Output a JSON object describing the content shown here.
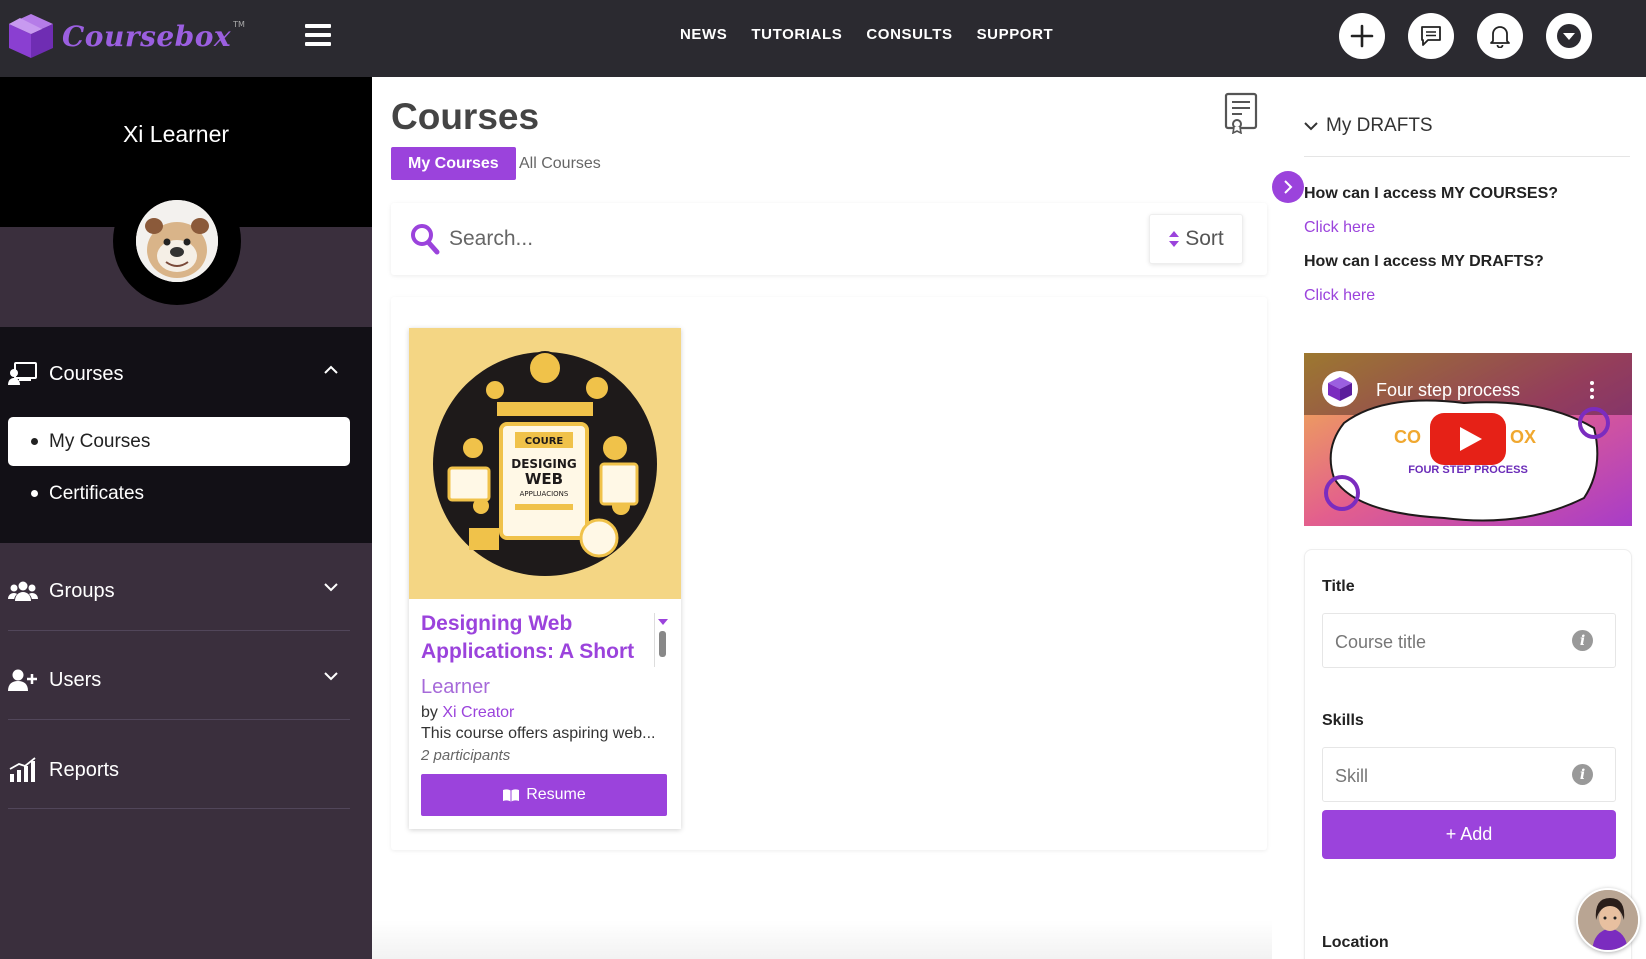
{
  "brand": {
    "name": "Coursebox",
    "tm": "TM"
  },
  "topnav": {
    "items": [
      "NEWS",
      "TUTORIALS",
      "CONSULTS",
      "SUPPORT"
    ]
  },
  "top_actions": [
    "plus-icon",
    "chat-icon",
    "bell-icon",
    "caret-down-icon"
  ],
  "profile": {
    "name": "Xi Learner"
  },
  "sidebar": {
    "courses": {
      "label": "Courses",
      "subitems": [
        "My Courses",
        "Certificates"
      ]
    },
    "groups": {
      "label": "Groups"
    },
    "users": {
      "label": "Users"
    },
    "reports": {
      "label": "Reports"
    }
  },
  "main": {
    "title": "Courses",
    "tabs": [
      "My Courses",
      "All Courses"
    ],
    "search_placeholder": "Search...",
    "sort_label": "Sort",
    "course": {
      "title": "Designing Web Applications: A Short",
      "role": "Learner",
      "by_prefix": "by",
      "creator": "Xi Creator",
      "description": "This course offers aspiring web...",
      "participants": "2 participants",
      "resume_label": "Resume",
      "image_text": [
        "COURE",
        "DESIGING",
        "WEB",
        "APPLUACIONS"
      ]
    }
  },
  "right": {
    "drafts_label": "My DRAFTS",
    "faq": [
      {
        "question": "How can I access MY COURSES?",
        "link": "Click here"
      },
      {
        "question": "How can I access MY DRAFTS?",
        "link": "Click here"
      }
    ],
    "video": {
      "title": "Four step process",
      "brand_text": "CO",
      "brand_text_end": "OX",
      "subtitle": "FOUR STEP PROCESS"
    },
    "form": {
      "title_label": "Title",
      "title_placeholder": "Course title",
      "skills_label": "Skills",
      "skill_placeholder": "Skill",
      "add_label": "+ Add",
      "location_label": "Location"
    }
  },
  "colors": {
    "accent": "#9b43dc",
    "topbar": "#2b2a30",
    "sidebar": "#3a2f3d"
  }
}
